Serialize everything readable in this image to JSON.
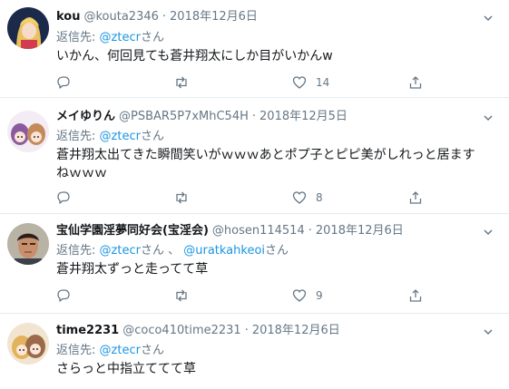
{
  "tweets": [
    {
      "name": "kou",
      "handle": "@kouta2346",
      "sep": "·",
      "date": "2018年12月6日",
      "reply_prefix": "返信先:",
      "mention1": "@ztecr",
      "mention1_suffix": "さん",
      "text": "いかん、何回見ても蒼井翔太にしか目がいかんw",
      "likes": "14"
    },
    {
      "name": "メイゆりん",
      "handle": "@PSBAR5P7xMhC54H",
      "sep": "·",
      "date": "2018年12月5日",
      "reply_prefix": "返信先:",
      "mention1": "@ztecr",
      "mention1_suffix": "さん",
      "text_line1": "蒼井翔太出てきた瞬間笑いがｗｗｗあとポプ子とピピ美がしれっと居ます",
      "text_line2": "ねｗｗｗ",
      "likes": "8"
    },
    {
      "name": "宝仙学園淫夢同好会(宝淫会)",
      "handle": "@hosen114514",
      "sep": "·",
      "date": "2018年12月6日",
      "reply_prefix": "返信先:",
      "mention1": "@ztecr",
      "mention1_suffix": "さん 、",
      "mention2": "@uratkahkeoi",
      "mention2_suffix": "さん",
      "text": "蒼井翔太ずっと走ってて草",
      "likes": "9"
    },
    {
      "name": "time2231",
      "handle": "@coco410time2231",
      "sep": "·",
      "date": "2018年12月6日",
      "reply_prefix": "返信先:",
      "mention1": "@ztecr",
      "mention1_suffix": "さん",
      "text": "さらっと中指立ててて草"
    }
  ],
  "colors": {
    "name": "#14171a",
    "secondary": "#657786",
    "mention": "#1b95e0",
    "border": "#e6ecf0"
  },
  "icons": [
    "reply-icon",
    "retweet-icon",
    "like-icon",
    "share-icon",
    "chevron-down-icon"
  ]
}
